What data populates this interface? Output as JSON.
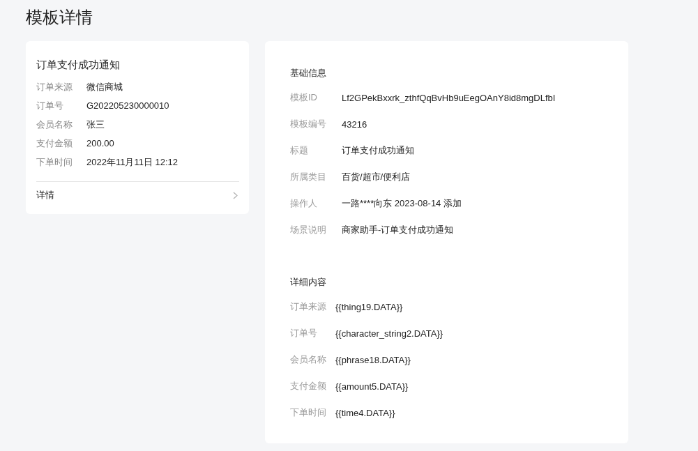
{
  "page_title": "模板详情",
  "preview": {
    "title": "订单支付成功通知",
    "fields": [
      {
        "label": "订单来源",
        "value": "微信商城"
      },
      {
        "label": "订单号",
        "value": "G202205230000010"
      },
      {
        "label": "会员名称",
        "value": "张三"
      },
      {
        "label": "支付金额",
        "value": "200.00"
      },
      {
        "label": "下单时间",
        "value": "2022年11月11日 12:12"
      }
    ],
    "detail_link": "详情"
  },
  "sections": [
    {
      "title": "基础信息",
      "fields": [
        {
          "label": "模板ID",
          "value": "Lf2GPekBxxrk_zthfQqBvHb9uEegOAnY8id8mgDLfbI"
        },
        {
          "label": "模板编号",
          "value": "43216"
        },
        {
          "label": "标题",
          "value": "订单支付成功通知"
        },
        {
          "label": "所属类目",
          "value": "百货/超市/便利店"
        },
        {
          "label": "操作人",
          "value": "一路****向东 2023-08-14 添加"
        },
        {
          "label": "场景说明",
          "value": "商家助手-订单支付成功通知"
        }
      ]
    },
    {
      "title": "详细内容",
      "fields": [
        {
          "label": "订单来源",
          "value": "{{thing19.DATA}}"
        },
        {
          "label": "订单号",
          "value": "{{character_string2.DATA}}"
        },
        {
          "label": "会员名称",
          "value": "{{phrase18.DATA}}"
        },
        {
          "label": "支付金额",
          "value": "{{amount5.DATA}}"
        },
        {
          "label": "下单时间",
          "value": "{{time4.DATA}}"
        }
      ]
    }
  ]
}
